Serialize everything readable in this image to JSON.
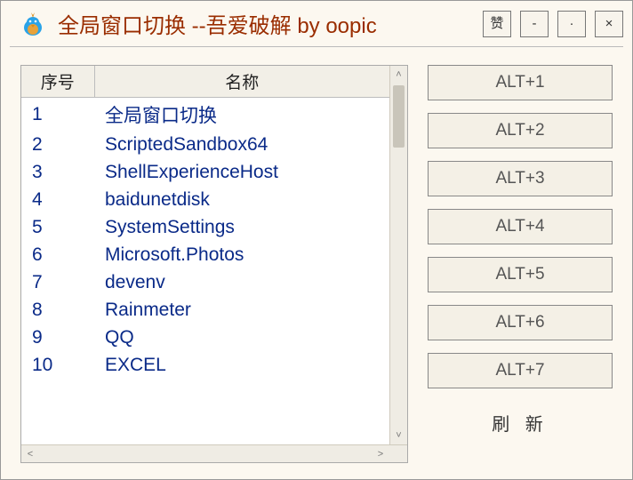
{
  "title": "全局窗口切换 --吾爱破解 by oopic",
  "titlebar": {
    "like": "赞",
    "minimize": "-",
    "dot": "·",
    "close": "×"
  },
  "table": {
    "headers": {
      "index": "序号",
      "name": "名称"
    },
    "rows": [
      {
        "idx": "1",
        "name": "全局窗口切换"
      },
      {
        "idx": "2",
        "name": "ScriptedSandbox64"
      },
      {
        "idx": "3",
        "name": "ShellExperienceHost"
      },
      {
        "idx": "4",
        "name": "baidunetdisk"
      },
      {
        "idx": "5",
        "name": "SystemSettings"
      },
      {
        "idx": "6",
        "name": "Microsoft.Photos"
      },
      {
        "idx": "7",
        "name": "devenv"
      },
      {
        "idx": "8",
        "name": "Rainmeter"
      },
      {
        "idx": "9",
        "name": "QQ"
      },
      {
        "idx": "10",
        "name": "EXCEL"
      }
    ]
  },
  "hotkeys": [
    "ALT+1",
    "ALT+2",
    "ALT+3",
    "ALT+4",
    "ALT+5",
    "ALT+6",
    "ALT+7"
  ],
  "refresh_label": "刷 新"
}
